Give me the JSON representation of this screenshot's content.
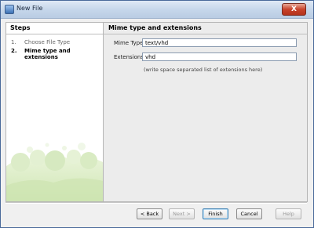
{
  "window": {
    "title": "New File",
    "close_label": "X"
  },
  "steps": {
    "heading": "Steps",
    "items": [
      {
        "num": "1.",
        "label": "Choose File Type",
        "state": "done"
      },
      {
        "num": "2.",
        "label": "Mime type and extensions",
        "state": "active"
      }
    ]
  },
  "content": {
    "heading": "Mime type and extensions",
    "mime_label": "Mime Type:",
    "mime_value": "text/vhd",
    "ext_label": "Extensions:",
    "ext_value": "vhd",
    "hint": "(write space separated list of extensions here)"
  },
  "buttons": {
    "back": "< Back",
    "next": "Next >",
    "finish": "Finish",
    "cancel": "Cancel",
    "help": "Help"
  }
}
